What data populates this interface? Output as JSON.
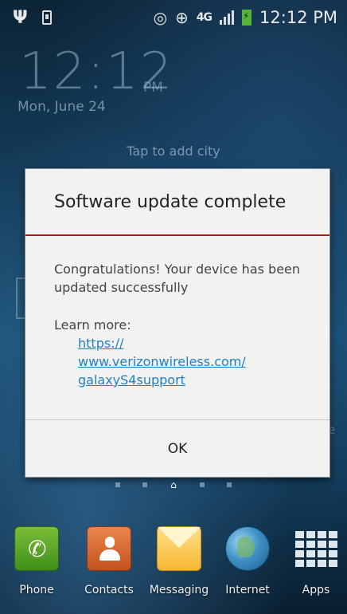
{
  "status_bar": {
    "time": "12:12 PM",
    "network": "4G",
    "icons": [
      "usb-icon",
      "phone-icon",
      "eye-icon",
      "gps-icon",
      "lte-icon",
      "signal-icon",
      "battery-charging-icon"
    ]
  },
  "lockscreen": {
    "clock": "12:12",
    "ampm": "PM",
    "date": "Mon, June 24",
    "city_prompt": "Tap to add city"
  },
  "dialog": {
    "title": "Software update complete",
    "message": "Congratulations! Your device has been updated successfully",
    "learn_more_label": "Learn more:",
    "link_lines": [
      "https://",
      "www.verizonwireless.com/",
      "galaxyS4support"
    ],
    "ok_label": "OK"
  },
  "dock": {
    "apps": [
      {
        "label": "Phone",
        "icon": "phone-icon"
      },
      {
        "label": "Contacts",
        "icon": "contacts-icon"
      },
      {
        "label": "Messaging",
        "icon": "messaging-icon"
      },
      {
        "label": "Internet",
        "icon": "globe-icon"
      },
      {
        "label": "Apps",
        "icon": "apps-grid-icon"
      }
    ]
  },
  "colors": {
    "accent_divider": "#b0171f",
    "link": "#1f7fc6",
    "battery": "#58b33a"
  }
}
